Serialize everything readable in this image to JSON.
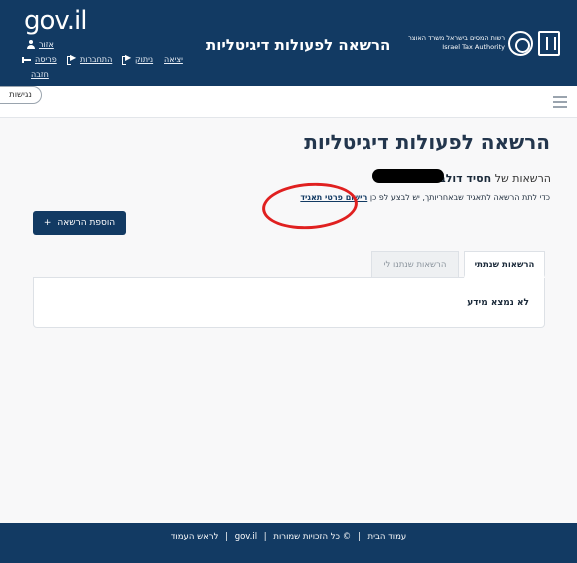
{
  "header": {
    "gov_logo": "gov.il",
    "title": "הרשאה לפעולות דיגיטליות",
    "authority_he": "רשות המסים בישראל משרד האוצר",
    "authority_en": "Israel Tax Authority",
    "account_links": {
      "personal_area": "אזור",
      "logout_line1": "יציאה",
      "logout_line2": "ניתוק",
      "connections": "התחברות",
      "crossing": "פריסה",
      "return": "חזבה"
    }
  },
  "subbar": {
    "accessibility": "נגישות"
  },
  "main": {
    "title": "הרשאה לפעולות דיגיטליות",
    "permissions_of_label": "הרשאות של",
    "user_name": "חסיד דולב",
    "description_prefix": "כדי לתת הרשאה לתאגיד שבאחריותך, יש לבצע לפ",
    "description_mid": "כן",
    "register_link": "רישום פרטי תאגיד",
    "add_button": "הוספת הרשאה",
    "add_icon": "+",
    "tabs": [
      {
        "label": "הרשאות שנתתי",
        "active": true
      },
      {
        "label": "הרשאות שנתנו לי",
        "active": false
      }
    ],
    "empty_message": "לא נמצא מידע"
  },
  "footer": {
    "home": "עמוד הבית",
    "rights": "© כל הזכויות שמורות",
    "gov": "gov.il",
    "top": "לראש העמוד",
    "separator": "|"
  },
  "colors": {
    "primary": "#123a63",
    "highlight": "#e02020"
  }
}
